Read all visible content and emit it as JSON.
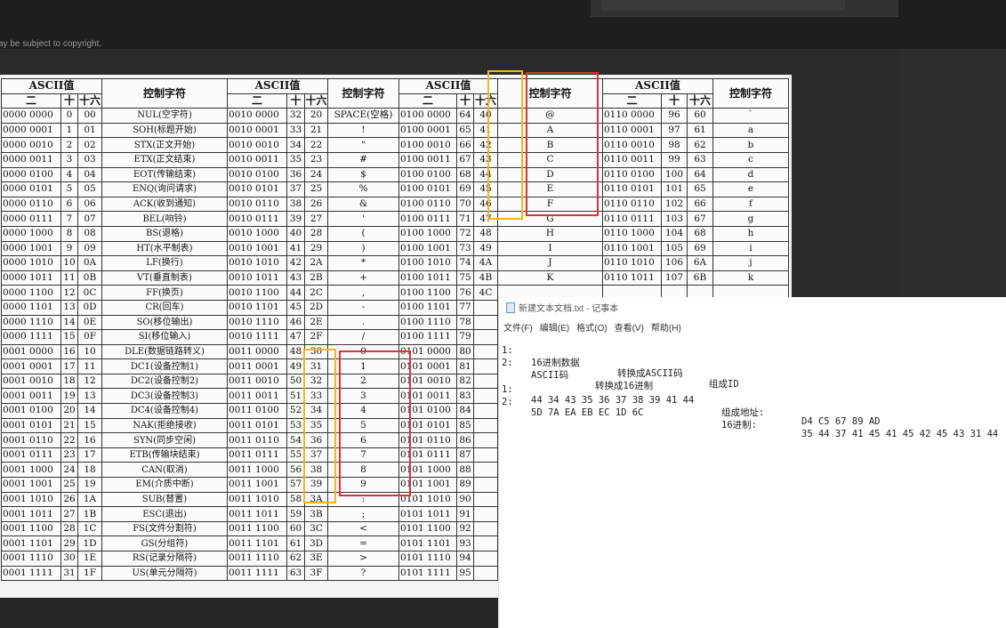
{
  "page": {
    "copyright_text": "ay be subject to copyright."
  },
  "ascii_table": {
    "headers": {
      "ascii_value": "ASCII值",
      "binary": "二",
      "decimal": "十",
      "hex": "十六",
      "control_char": "控制字符"
    },
    "rows": [
      [
        "0000 0000",
        "0",
        "00",
        "NUL(空字符)",
        "0010 0000",
        "32",
        "20",
        "SPACE(空格)",
        "0100 0000",
        "64",
        "40",
        "@",
        "0110 0000",
        "96",
        "60",
        "`"
      ],
      [
        "0000 0001",
        "1",
        "01",
        "SOH(标题开始)",
        "0010 0001",
        "33",
        "21",
        "!",
        "0100 0001",
        "65",
        "41",
        "A",
        "0110 0001",
        "97",
        "61",
        "a"
      ],
      [
        "0000 0010",
        "2",
        "02",
        "STX(正文开始)",
        "0010 0010",
        "34",
        "22",
        "\"",
        "0100 0010",
        "66",
        "42",
        "B",
        "0110 0010",
        "98",
        "62",
        "b"
      ],
      [
        "0000 0011",
        "3",
        "03",
        "ETX(正文结束)",
        "0010 0011",
        "35",
        "23",
        "#",
        "0100 0011",
        "67",
        "43",
        "C",
        "0110 0011",
        "99",
        "63",
        "c"
      ],
      [
        "0000 0100",
        "4",
        "04",
        "EOT(传输结束)",
        "0010 0100",
        "36",
        "24",
        "$",
        "0100 0100",
        "68",
        "44",
        "D",
        "0110 0100",
        "100",
        "64",
        "d"
      ],
      [
        "0000 0101",
        "5",
        "05",
        "ENQ(询问请求)",
        "0010 0101",
        "37",
        "25",
        "%",
        "0100 0101",
        "69",
        "45",
        "E",
        "0110 0101",
        "101",
        "65",
        "e"
      ],
      [
        "0000 0110",
        "6",
        "06",
        "ACK(收到通知)",
        "0010 0110",
        "38",
        "26",
        "&",
        "0100 0110",
        "70",
        "46",
        "F",
        "0110 0110",
        "102",
        "66",
        "f"
      ],
      [
        "0000 0111",
        "7",
        "07",
        "BEL(响铃)",
        "0010 0111",
        "39",
        "27",
        "'",
        "0100 0111",
        "71",
        "47",
        "G",
        "0110 0111",
        "103",
        "67",
        "g"
      ],
      [
        "0000 1000",
        "8",
        "08",
        "BS(退格)",
        "0010 1000",
        "40",
        "28",
        "(",
        "0100 1000",
        "72",
        "48",
        "H",
        "0110 1000",
        "104",
        "68",
        "h"
      ],
      [
        "0000 1001",
        "9",
        "09",
        "HT(水平制表)",
        "0010 1001",
        "41",
        "29",
        ")",
        "0100 1001",
        "73",
        "49",
        "I",
        "0110 1001",
        "105",
        "69",
        "i"
      ],
      [
        "0000 1010",
        "10",
        "0A",
        "LF(换行)",
        "0010 1010",
        "42",
        "2A",
        "*",
        "0100 1010",
        "74",
        "4A",
        "J",
        "0110 1010",
        "106",
        "6A",
        "j"
      ],
      [
        "0000 1011",
        "11",
        "0B",
        "VT(垂直制表)",
        "0010 1011",
        "43",
        "2B",
        "+",
        "0100 1011",
        "75",
        "4B",
        "K",
        "0110 1011",
        "107",
        "6B",
        "k"
      ],
      [
        "0000 1100",
        "12",
        "0C",
        "FF(换页)",
        "0010 1100",
        "44",
        "2C",
        ",",
        "0100 1100",
        "76",
        "4C",
        "",
        "",
        "",
        "",
        ""
      ],
      [
        "0000 1101",
        "13",
        "0D",
        "CR(回车)",
        "0010 1101",
        "45",
        "2D",
        "-",
        "0100 1101",
        "77",
        "",
        "",
        "",
        "",
        "",
        ""
      ],
      [
        "0000 1110",
        "14",
        "0E",
        "SO(移位输出)",
        "0010 1110",
        "46",
        "2E",
        ".",
        "0100 1110",
        "78",
        "",
        "",
        "",
        "",
        "",
        ""
      ],
      [
        "0000 1111",
        "15",
        "0F",
        "SI(移位输入)",
        "0010 1111",
        "47",
        "2F",
        "/",
        "0100 1111",
        "79",
        "",
        "",
        "",
        "",
        "",
        ""
      ],
      [
        "0001 0000",
        "16",
        "10",
        "DLE(数据链路转义)",
        "0011 0000",
        "48",
        "30",
        "0",
        "0101 0000",
        "80",
        "",
        "",
        "",
        "",
        "",
        ""
      ],
      [
        "0001 0001",
        "17",
        "11",
        "DC1(设备控制1)",
        "0011 0001",
        "49",
        "31",
        "1",
        "0101 0001",
        "81",
        "",
        "",
        "",
        "",
        "",
        ""
      ],
      [
        "0001 0010",
        "18",
        "12",
        "DC2(设备控制2)",
        "0011 0010",
        "50",
        "32",
        "2",
        "0101 0010",
        "82",
        "",
        "",
        "",
        "",
        "",
        ""
      ],
      [
        "0001 0011",
        "19",
        "13",
        "DC3(设备控制3)",
        "0011 0011",
        "51",
        "33",
        "3",
        "0101 0011",
        "83",
        "",
        "",
        "",
        "",
        "",
        ""
      ],
      [
        "0001 0100",
        "20",
        "14",
        "DC4(设备控制4)",
        "0011 0100",
        "52",
        "34",
        "4",
        "0101 0100",
        "84",
        "",
        "",
        "",
        "",
        "",
        ""
      ],
      [
        "0001 0101",
        "21",
        "15",
        "NAK(拒绝接收)",
        "0011 0101",
        "53",
        "35",
        "5",
        "0101 0101",
        "85",
        "",
        "",
        "",
        "",
        "",
        ""
      ],
      [
        "0001 0110",
        "22",
        "16",
        "SYN(同步空闲)",
        "0011 0110",
        "54",
        "36",
        "6",
        "0101 0110",
        "86",
        "",
        "",
        "",
        "",
        "",
        ""
      ],
      [
        "0001 0111",
        "23",
        "17",
        "ETB(传输块结束)",
        "0011 0111",
        "55",
        "37",
        "7",
        "0101 0111",
        "87",
        "",
        "",
        "",
        "",
        "",
        ""
      ],
      [
        "0001 1000",
        "24",
        "18",
        "CAN(取消)",
        "0011 1000",
        "56",
        "38",
        "8",
        "0101 1000",
        "88",
        "",
        "",
        "",
        "",
        "",
        ""
      ],
      [
        "0001 1001",
        "25",
        "19",
        "EM(介质中断)",
        "0011 1001",
        "57",
        "39",
        "9",
        "0101 1001",
        "89",
        "",
        "",
        "",
        "",
        "",
        ""
      ],
      [
        "0001 1010",
        "26",
        "1A",
        "SUB(替置)",
        "0011 1010",
        "58",
        "3A",
        ":",
        "0101 1010",
        "90",
        "",
        "",
        "",
        "",
        "",
        ""
      ],
      [
        "0001 1011",
        "27",
        "1B",
        "ESC(退出)",
        "0011 1011",
        "59",
        "3B",
        ";",
        "0101 1011",
        "91",
        "",
        "",
        "",
        "",
        "",
        ""
      ],
      [
        "0001 1100",
        "28",
        "1C",
        "FS(文件分割符)",
        "0011 1100",
        "60",
        "3C",
        "<",
        "0101 1100",
        "92",
        "",
        "",
        "",
        "",
        "",
        ""
      ],
      [
        "0001 1101",
        "29",
        "1D",
        "GS(分组符)",
        "0011 1101",
        "61",
        "3D",
        "=",
        "0101 1101",
        "93",
        "",
        "",
        "",
        "",
        "",
        ""
      ],
      [
        "0001 1110",
        "30",
        "1E",
        "RS(记录分隔符)",
        "0011 1110",
        "62",
        "3E",
        ">",
        "0101 1110",
        "94",
        "",
        "",
        "",
        "",
        "",
        ""
      ],
      [
        "0001 1111",
        "31",
        "1F",
        "US(单元分隔符)",
        "0011 1111",
        "63",
        "3F",
        "?",
        "0101 1111",
        "95",
        "",
        "",
        "",
        "",
        "",
        ""
      ]
    ]
  },
  "highlights": {
    "yellow": "#f2b61e",
    "red": "#e03030"
  },
  "notepad": {
    "title": "新建文本文档.txt - 记事本",
    "menu": [
      "文件(F)",
      "编辑(E)",
      "格式(O)",
      "查看(V)",
      "帮助(H)"
    ],
    "lines": [
      {
        "num": "1:",
        "a": "16进制数据",
        "b": "转换成ASCII码",
        "c": "组成ID"
      },
      {
        "num": "2:",
        "a": "ASCII码",
        "b": "转换成16进制",
        "c": ""
      }
    ],
    "data_lines": [
      {
        "num": "1:",
        "hex": "44 34 43 35 36 37 38 39 41 44",
        "label": "组成地址:",
        "value": "D4 C5 67 89 AD"
      },
      {
        "num": "2:",
        "hex": "5D 7A EA EB EC 1D 6C",
        "label": "16进制:",
        "value": "35 44 37 41 45 41 45 42 45 43 31 44"
      }
    ]
  }
}
